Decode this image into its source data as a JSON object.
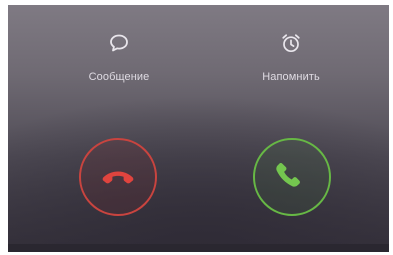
{
  "actions": {
    "message": {
      "label": "Сообщение",
      "icon": "message-bubble-icon"
    },
    "remind": {
      "label": "Напомнить",
      "icon": "alarm-clock-icon"
    }
  },
  "call_buttons": {
    "decline": {
      "icon": "phone-hangup-icon",
      "color": "#d94843"
    },
    "accept": {
      "icon": "phone-answer-icon",
      "color": "#6cc04a"
    }
  }
}
